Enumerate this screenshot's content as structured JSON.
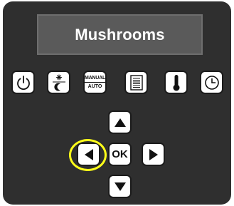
{
  "display": {
    "text": "Mushrooms"
  },
  "function_buttons": [
    {
      "name": "power-button",
      "icon": "power-icon"
    },
    {
      "name": "day-night-button",
      "icon": "sun-moon-icon"
    },
    {
      "name": "manual-auto-button",
      "top_label": "MANUAL",
      "bottom_label": "AUTO"
    },
    {
      "name": "document-button",
      "icon": "document-icon"
    },
    {
      "name": "temperature-button",
      "icon": "thermometer-icon"
    },
    {
      "name": "clock-button",
      "icon": "clock-icon"
    }
  ],
  "nav": {
    "ok_label": "OK"
  },
  "highlight": {
    "target": "left-arrow-button",
    "color": "#ffff19"
  },
  "colors": {
    "panel": "#2f2f2f",
    "display_background": "#5a5a5a",
    "display_text": "#ffffff",
    "button_background": "#ffffff"
  }
}
